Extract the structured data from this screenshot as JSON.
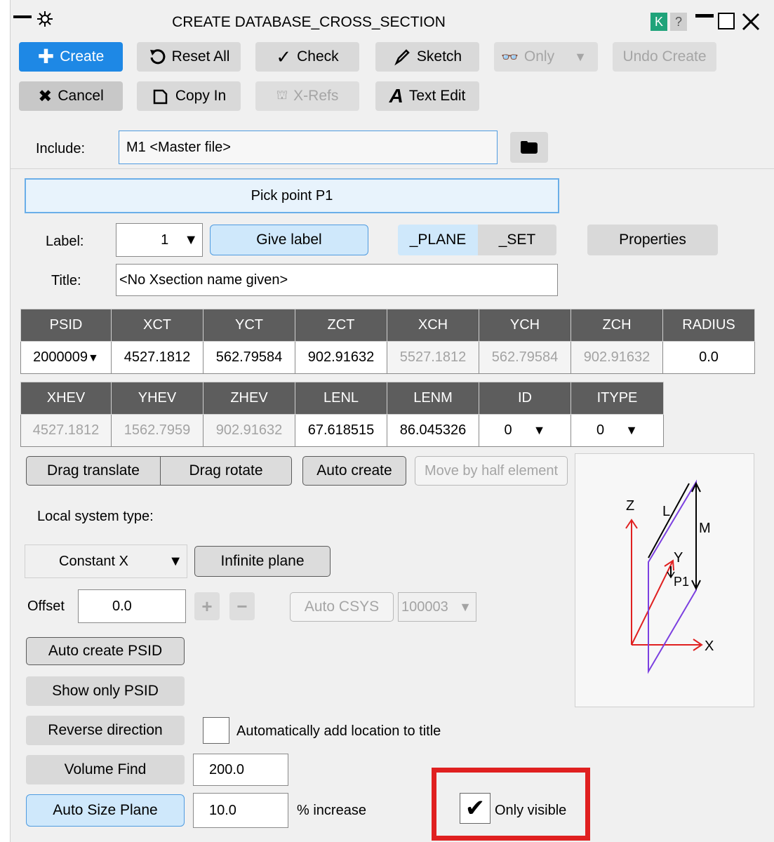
{
  "window": {
    "title": "CREATE DATABASE_CROSS_SECTION",
    "controls": {
      "k": "K",
      "help": "?"
    }
  },
  "toolbar": {
    "create": "Create",
    "reset_all": "Reset All",
    "check": "Check",
    "sketch": "Sketch",
    "only": "Only",
    "undo_create": "Undo Create",
    "cancel": "Cancel",
    "copy_in": "Copy In",
    "x_refs": "X-Refs",
    "text_edit": "Text Edit"
  },
  "include": {
    "label": "Include:",
    "value": "M1  <Master file>"
  },
  "pick": {
    "prompt": "Pick point P1"
  },
  "label_row": {
    "label": "Label:",
    "value": "1",
    "give_label": "Give label",
    "tab_plane": "_PLANE",
    "tab_set": "_SET",
    "properties": "Properties"
  },
  "title_row": {
    "label": "Title:",
    "value": "<No Xsection name given>"
  },
  "table1": {
    "headers": [
      "PSID",
      "XCT",
      "YCT",
      "ZCT",
      "XCH",
      "YCH",
      "ZCH",
      "RADIUS"
    ],
    "values": [
      "2000009",
      "4527.1812",
      "562.79584",
      "902.91632",
      "5527.1812",
      "562.79584",
      "902.91632",
      "0.0"
    ]
  },
  "table2": {
    "headers": [
      "XHEV",
      "YHEV",
      "ZHEV",
      "LENL",
      "LENM",
      "ID",
      "ITYPE"
    ],
    "values": [
      "4527.1812",
      "1562.7959",
      "902.91632",
      "67.618515",
      "86.045326",
      "0",
      "0"
    ]
  },
  "drag": {
    "translate": "Drag translate",
    "rotate": "Drag rotate",
    "auto_create": "Auto create",
    "move_half": "Move by half element"
  },
  "local_system": {
    "label": "Local system type:",
    "value": "Constant X",
    "infinite_plane": "Infinite plane"
  },
  "offset": {
    "label": "Offset",
    "value": "0.0",
    "plus": "+",
    "minus": "−",
    "auto_csys": "Auto CSYS",
    "csys_value": "100003"
  },
  "buttons": {
    "auto_create_psid": "Auto create PSID",
    "show_only_psid": "Show only PSID",
    "reverse_direction": "Reverse direction",
    "auto_add_location": "Automatically add location to title",
    "volume_find": "Volume Find",
    "volume_value": "200.0",
    "auto_size_plane": "Auto Size Plane",
    "auto_size_value": "10.0",
    "increase_label": "% increase",
    "only_visible": "Only visible",
    "only_visible_checked": true
  },
  "diagram": {
    "z": "Z",
    "l": "L",
    "m": "M",
    "y": "Y",
    "p1": "P1",
    "x": "X"
  },
  "colors": {
    "accent": "#1e88e5",
    "highlight": "#e02020",
    "header": "#5d5d5d"
  }
}
